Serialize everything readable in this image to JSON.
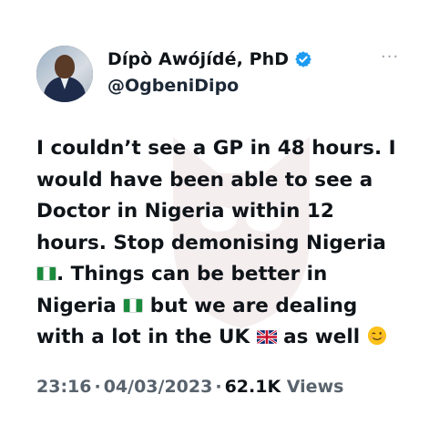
{
  "author": {
    "display_name": "Dípò Awójídé, PhD",
    "handle": "@OgbeniDipo",
    "verified_icon": "verified-badge-icon",
    "avatar_icon": "profile-photo"
  },
  "menu": {
    "more_label": "···"
  },
  "tweet": {
    "segments": {
      "l1": "I couldn’t see a GP in 48 hours. I",
      "l2": "would have been able to see a",
      "l3": "Doctor in Nigeria within 12",
      "l4": "hours. Stop demonising Nigeria",
      "l5a": ". Things can be better in",
      "l6a": "Nigeria ",
      "l6b": " but we are dealing",
      "l7a": "with a lot in the UK ",
      "l7b": " as well "
    },
    "emojis": [
      "nigeria-flag",
      "nigeria-flag",
      "uk-flag",
      "winking-face"
    ]
  },
  "meta": {
    "time": "23:16",
    "separator": "·",
    "date": "04/03/2023",
    "views_count": "62.1K",
    "views_label": "Views"
  },
  "colors": {
    "verified_blue": "#1d9bf0",
    "meta_gray": "#59636d",
    "text": "#0f1419"
  }
}
